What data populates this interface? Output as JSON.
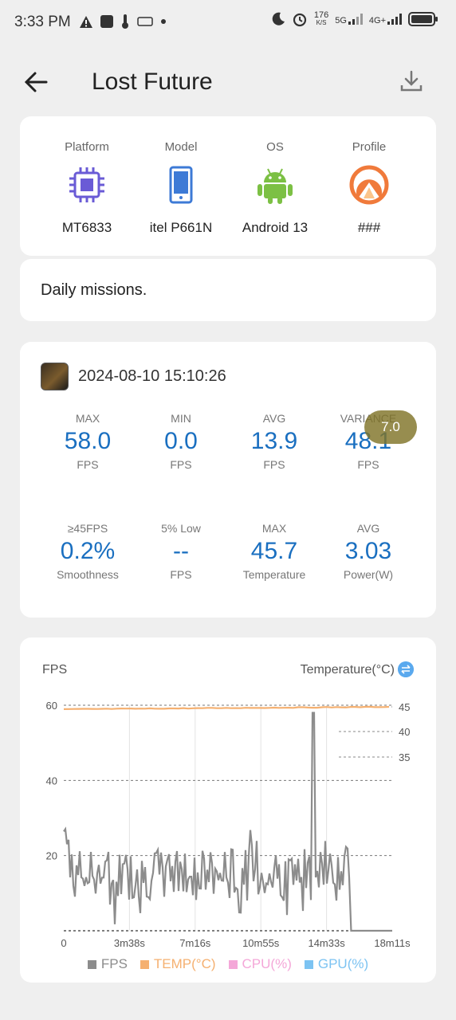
{
  "status_bar": {
    "time": "3:33 PM",
    "net_speed": "176",
    "net_unit": "K/S",
    "net1": "5G",
    "net2": "4G+"
  },
  "header": {
    "title": "Lost Future"
  },
  "device": {
    "items": [
      {
        "label": "Platform",
        "value": "MT6833",
        "icon": "chip-icon"
      },
      {
        "label": "Model",
        "value": "itel P661N",
        "icon": "phone-icon"
      },
      {
        "label": "OS",
        "value": "Android 13",
        "icon": "android-icon"
      },
      {
        "label": "Profile",
        "value": "###",
        "icon": "profile-icon"
      }
    ]
  },
  "missions": {
    "text": "Daily missions."
  },
  "session": {
    "date": "2024-08-10 15:10:26",
    "badge": "7.0",
    "stats": [
      {
        "label": "MAX",
        "value": "58.0",
        "unit": "FPS"
      },
      {
        "label": "MIN",
        "value": "0.0",
        "unit": "FPS"
      },
      {
        "label": "AVG",
        "value": "13.9",
        "unit": "FPS"
      },
      {
        "label": "VARIANCE",
        "value": "48.1",
        "unit": "FPS"
      },
      {
        "label": "≥45FPS",
        "value": "0.2%",
        "unit": "Smoothness"
      },
      {
        "label": "5% Low",
        "value": "--",
        "unit": "FPS"
      },
      {
        "label": "MAX",
        "value": "45.7",
        "unit": "Temperature"
      },
      {
        "label": "AVG",
        "value": "3.03",
        "unit": "Power(W)"
      }
    ]
  },
  "chart_header": {
    "left": "FPS",
    "right": "Temperature(°C)"
  },
  "chart_data": {
    "type": "line",
    "x_tick_labels": [
      "0",
      "3m38s",
      "7m16s",
      "10m55s",
      "14m33s",
      "18m11s"
    ],
    "y_left_ticks": [
      "20",
      "40",
      "60"
    ],
    "y_right_ticks": [
      "35",
      "40",
      "45"
    ],
    "ylim_left": [
      0,
      60
    ],
    "series": [
      {
        "name": "FPS",
        "color": "#8c8c8c"
      },
      {
        "name": "TEMP(°C)",
        "color": "#f5b070"
      },
      {
        "name": "CPU(%)",
        "color": "#f4a7d8"
      },
      {
        "name": "GPU(%)",
        "color": "#7cc3f2"
      }
    ]
  }
}
